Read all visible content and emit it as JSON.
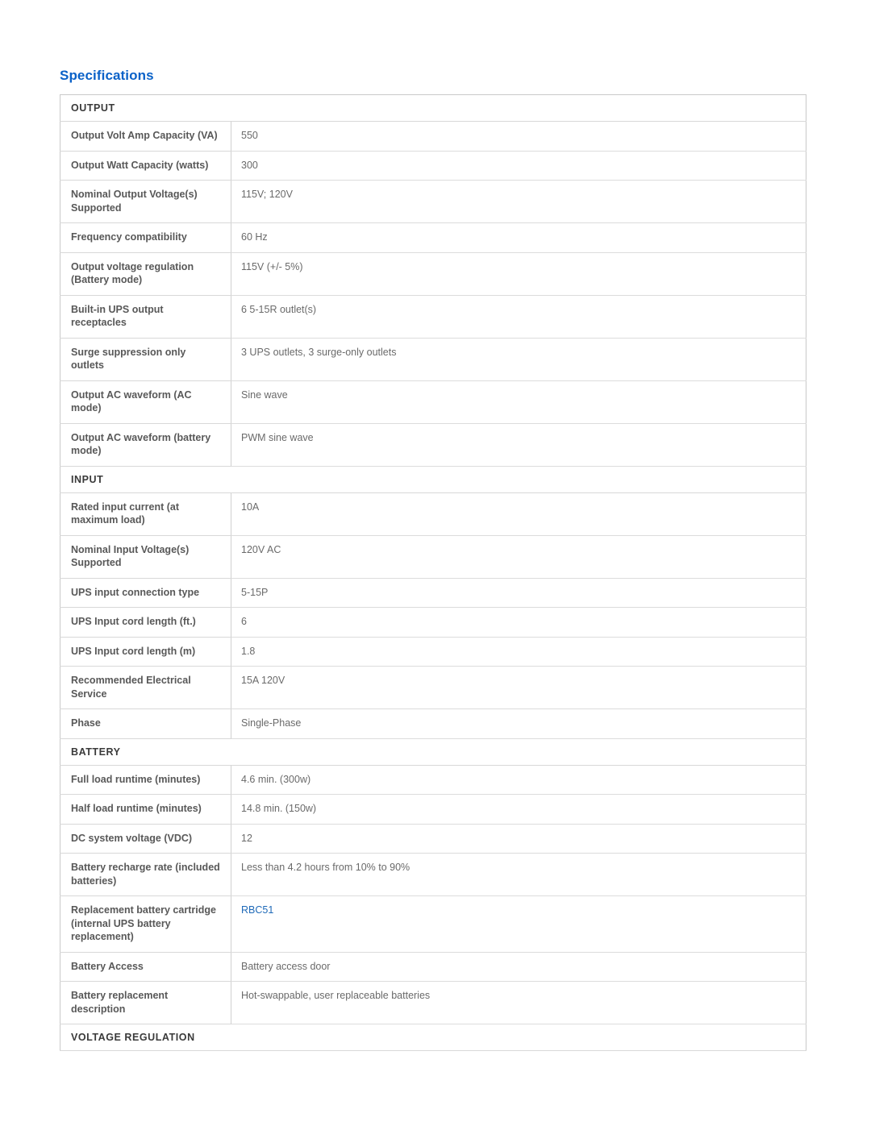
{
  "page": {
    "title": "Specifications",
    "title_color": "#0b62c8",
    "link_color": "#1f6ab8",
    "label_color": "#585858",
    "value_color": "#6a6a6a"
  },
  "sections": [
    {
      "heading": "OUTPUT",
      "rows": [
        {
          "label": "Output Volt Amp Capacity (VA)",
          "value": "550"
        },
        {
          "label": "Output Watt Capacity (watts)",
          "value": "300"
        },
        {
          "label": "Nominal Output Voltage(s) Supported",
          "value": "115V; 120V"
        },
        {
          "label": "Frequency compatibility",
          "value": "60 Hz"
        },
        {
          "label": "Output voltage regulation (Battery mode)",
          "value": "115V (+/- 5%)"
        },
        {
          "label": "Built-in UPS output receptacles",
          "value": "6 5-15R outlet(s)"
        },
        {
          "label": "Surge suppression only outlets",
          "value": "3 UPS outlets, 3 surge-only outlets"
        },
        {
          "label": "Output AC waveform (AC mode)",
          "value": "Sine wave"
        },
        {
          "label": "Output AC waveform (battery mode)",
          "value": "PWM sine wave"
        }
      ]
    },
    {
      "heading": "INPUT",
      "rows": [
        {
          "label": "Rated input current (at maximum load)",
          "value": "10A"
        },
        {
          "label": "Nominal Input Voltage(s) Supported",
          "value": "120V AC"
        },
        {
          "label": "UPS input connection type",
          "value": "5-15P"
        },
        {
          "label": "UPS Input cord length (ft.)",
          "value": "6"
        },
        {
          "label": "UPS Input cord length (m)",
          "value": "1.8"
        },
        {
          "label": "Recommended Electrical Service",
          "value": "15A 120V"
        },
        {
          "label": "Phase",
          "value": "Single-Phase"
        }
      ]
    },
    {
      "heading": "BATTERY",
      "rows": [
        {
          "label": "Full load runtime (minutes)",
          "value": "4.6 min. (300w)"
        },
        {
          "label": "Half load runtime (minutes)",
          "value": "14.8 min. (150w)"
        },
        {
          "label": "DC system voltage (VDC)",
          "value": "12"
        },
        {
          "label": "Battery recharge rate (included batteries)",
          "value": "Less than 4.2 hours from 10% to 90%"
        },
        {
          "label": "Replacement battery cartridge (internal UPS battery replacement)",
          "value": "RBC51",
          "is_link": true
        },
        {
          "label": "Battery Access",
          "value": "Battery access door"
        },
        {
          "label": "Battery replacement description",
          "value": "Hot-swappable, user replaceable batteries"
        }
      ]
    },
    {
      "heading": "VOLTAGE REGULATION",
      "rows": []
    }
  ]
}
